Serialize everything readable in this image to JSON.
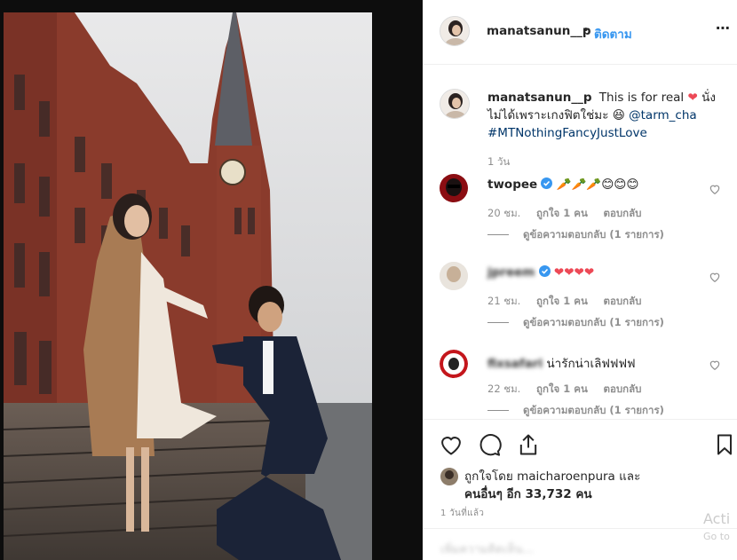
{
  "post": {
    "author": "manatsanun__p",
    "separator": "•",
    "follow_label": "ติดตาม",
    "more_icon": "⋯"
  },
  "caption": {
    "author": "manatsanun__p",
    "text_part1": "This is for real",
    "heart": "❤",
    "text_part2": "นั่งไม่ได้เพราะเกงฟิตใช่มะ",
    "emoji": "😆",
    "mention": "@tarm_cha",
    "hashtag": "#MTNothingFancyJustLove",
    "time": "1 วัน"
  },
  "comments": [
    {
      "user": "twopee",
      "verified": true,
      "text": "🥕🥕🥕😊😊😊",
      "time": "20 ชม.",
      "likes": "ถูกใจ 1 คน",
      "reply": "ตอบกลับ",
      "view_replies": "ดูข้อความตอบกลับ (1 รายการ)"
    },
    {
      "user": "jpreem",
      "verified": true,
      "text": "❤❤❤❤",
      "time": "21 ชม.",
      "likes": "ถูกใจ 1 คน",
      "reply": "ตอบกลับ",
      "view_replies": "ดูข้อความตอบกลับ (1 รายการ)"
    },
    {
      "user": "fixsafari",
      "verified": false,
      "text": "น่ารักน่าเลิฟฟฟฟ",
      "time": "22 ชม.",
      "likes": "ถูกใจ 1 คน",
      "reply": "ตอบกลับ",
      "view_replies": "ดูข้อความตอบกลับ (1 รายการ)"
    }
  ],
  "likes": {
    "line1": "ถูกใจโดย maicharoenpura และ",
    "line2": "คนอื่นๆ อีก 33,732 คน"
  },
  "posted_time": "1 วันที่แล้ว",
  "add_comment_placeholder": "เพิ่มความคิดเห็น...",
  "watermark": {
    "title": "Acti",
    "sub": "Go to"
  },
  "colors": {
    "link": "#3897f0",
    "heart": "#ed4956",
    "verified": "#3897f0"
  }
}
